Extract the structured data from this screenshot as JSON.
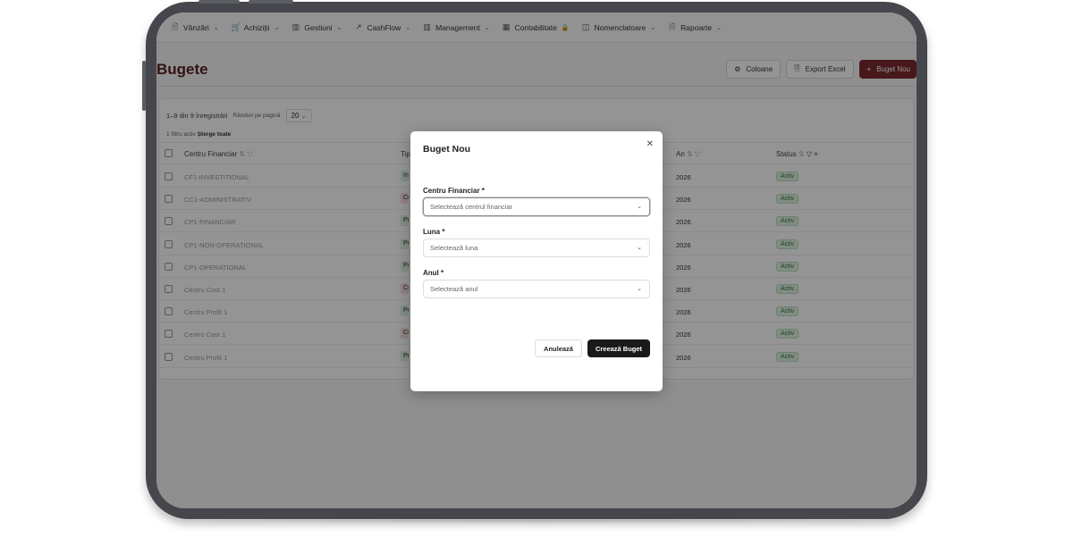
{
  "nav": {
    "items": [
      {
        "label": "Vânzări",
        "icon": "receipt-icon",
        "glyph": "🗎"
      },
      {
        "label": "Achiziții",
        "icon": "cart-icon",
        "glyph": "🛒"
      },
      {
        "label": "Gestiuni",
        "icon": "chart-icon",
        "glyph": "▥"
      },
      {
        "label": "CashFlow",
        "icon": "trend-icon",
        "glyph": "↗"
      },
      {
        "label": "Management",
        "icon": "chart-icon",
        "glyph": "▥"
      },
      {
        "label": "Contabilitate",
        "icon": "calculator-icon",
        "glyph": "▦"
      },
      {
        "label": "Nomenclatoare",
        "icon": "book-icon",
        "glyph": "◫"
      },
      {
        "label": "Rapoarte",
        "icon": "report-icon",
        "glyph": "🗎"
      }
    ]
  },
  "page": {
    "title": "Bugete",
    "columns_label": "Coloane",
    "export_label": "Export Excel",
    "new_label": "Buget Nou"
  },
  "list": {
    "records": "1–9 din 9 înregistrări",
    "rows_per_page_label": "Rânduri pe pagină",
    "rows_per_page": "20",
    "filters_active": "1 filtru activ",
    "clear_all": "Șterge toate",
    "headers": {
      "centru": "Centru Financiar",
      "tip": "Tip",
      "an": "An",
      "status": "Status"
    },
    "rows": [
      {
        "name": "CF1-INVESTITIONAL",
        "tip": "In",
        "tip_color": "#dff1e2",
        "an": "2026",
        "status": "Activ"
      },
      {
        "name": "CC1-ADMINISTRATIV",
        "tip": "Co",
        "tip_color": "#f6dede",
        "an": "2026",
        "status": "Activ"
      },
      {
        "name": "CP1-FINANCIAR",
        "tip": "Pr",
        "tip_color": "#dff1e2",
        "an": "2026",
        "status": "Activ"
      },
      {
        "name": "CP1-NON-OPERATIONAL",
        "tip": "Pr",
        "tip_color": "#dff1e2",
        "an": "2026",
        "status": "Activ"
      },
      {
        "name": "CP1-OPERATIONAL",
        "tip": "Pr",
        "tip_color": "#dff1e2",
        "an": "2026",
        "status": "Activ"
      },
      {
        "name": "Centru Cost 1",
        "tip": "Co",
        "tip_color": "#f6dede",
        "an": "2026",
        "status": "Activ"
      },
      {
        "name": "Centru Profit 1",
        "tip": "Pr",
        "tip_color": "#dff1e2",
        "an": "2026",
        "status": "Activ"
      },
      {
        "name": "Centru Cost 1",
        "tip": "Co",
        "tip_color": "#f6dede",
        "an": "2026",
        "status": "Activ"
      },
      {
        "name": "Centru Profit 1",
        "tip": "Pr",
        "tip_color": "#dff1e2",
        "an": "2026",
        "status": "Activ"
      }
    ]
  },
  "modal": {
    "title": "Buget Nou",
    "centru_label": "Centru Financiar *",
    "centru_placeholder": "Selectează centrul financiar",
    "luna_label": "Luna *",
    "luna_placeholder": "Selectează luna",
    "anul_label": "Anul *",
    "anul_placeholder": "Selectează anul",
    "cancel_label": "Anulează",
    "create_label": "Creează Buget"
  }
}
